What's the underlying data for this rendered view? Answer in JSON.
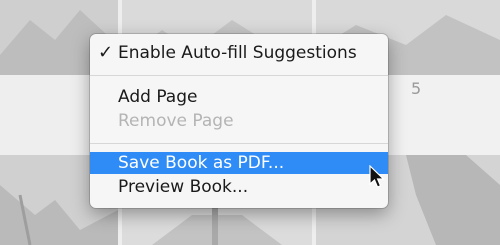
{
  "background": {
    "page_number": "5"
  },
  "context_menu": {
    "items": [
      {
        "label": "Enable Auto-fill Suggestions",
        "checked": true,
        "enabled": true
      },
      {
        "label": "Add Page",
        "enabled": true
      },
      {
        "label": "Remove Page",
        "enabled": false
      },
      {
        "label": "Save Book as PDF...",
        "enabled": true,
        "highlighted": true
      },
      {
        "label": "Preview Book...",
        "enabled": true
      }
    ],
    "check_glyph": "✓"
  },
  "colors": {
    "highlight": "#2f8cf6",
    "menu_bg": "#f6f6f6",
    "disabled_text": "#b4b4b4"
  }
}
